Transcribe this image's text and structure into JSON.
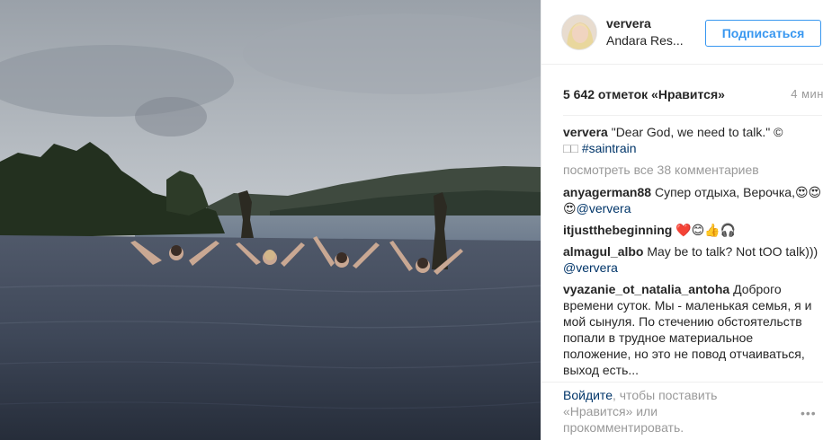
{
  "post": {
    "username": "ververa",
    "location": "Andara Res...",
    "follow_label": "Подписаться",
    "likes": "5 642 отметок «Нравится»",
    "time_ago": "4 мин"
  },
  "caption": {
    "author": "ververa",
    "text": " \"Dear God, we need to talk.\" © ",
    "text2": "□□ ",
    "hashtag": "#saintrain"
  },
  "view_all": "посмотреть все 38 комментариев",
  "comments": [
    {
      "author": "anyagerman88",
      "text": " Супер отдыха, Верочка,😍😍😍",
      "mention": "@ververa"
    },
    {
      "author": "itjustthebeginning",
      "text": " ❤️😊👍🎧",
      "mention": ""
    },
    {
      "author": "almagul_albo",
      "text": " May be to talk? Not tOO talk))) ",
      "mention": "@ververa"
    },
    {
      "author": "vyazanie_ot_natalia_antoha",
      "text": " Доброго времени суток. Мы - маленькая семья, я и мой сынуля. По стечению обстоятельств попали в трудное материальное положение, но это не повод отчаиваться, выход есть...",
      "mention": ""
    }
  ],
  "footer": {
    "login_link": "Войдите",
    "login_text": ", чтобы поставить «Нравится» или прокомментировать.",
    "more": "•••"
  },
  "colors": {
    "link_blue": "#003569",
    "button_blue": "#3897f0",
    "muted": "#999999"
  }
}
